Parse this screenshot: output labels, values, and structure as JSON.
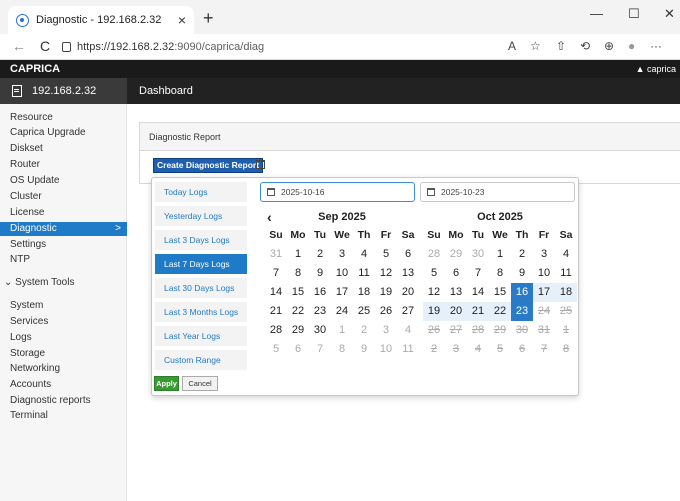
{
  "browser": {
    "tab_title": "Diagnostic - 192.168.2.32",
    "tab_close": "×",
    "new_tab": "+",
    "url_host": "https://192.168.2.32",
    "url_path": ":9090/caprica/diag",
    "window_min": "—",
    "window_max": "☐",
    "window_close": "✕",
    "back": "←",
    "refresh": "C",
    "tools": [
      "A",
      "☆",
      "⇧",
      "⟲",
      "⊕",
      "●",
      "···"
    ]
  },
  "app": {
    "name": "CAPRICA",
    "user": "caprica",
    "device": "192.168.2.32",
    "page_title": "Dashboard"
  },
  "sidebar": {
    "items": [
      {
        "label": "Resource"
      },
      {
        "label": "Caprica Upgrade"
      },
      {
        "label": "Diskset"
      },
      {
        "label": "Router"
      },
      {
        "label": "OS Update"
      },
      {
        "label": "Cluster"
      },
      {
        "label": "License"
      },
      {
        "label": "Diagnostic",
        "active": true,
        "chevron": ">"
      },
      {
        "label": "Settings"
      },
      {
        "label": "NTP"
      }
    ],
    "section": {
      "label": "System Tools",
      "chevron": "⌄"
    },
    "tools": [
      {
        "label": "System"
      },
      {
        "label": "Services"
      },
      {
        "label": "Logs"
      },
      {
        "label": "Storage"
      },
      {
        "label": "Networking"
      },
      {
        "label": "Accounts"
      },
      {
        "label": "Diagnostic reports"
      },
      {
        "label": "Terminal"
      }
    ]
  },
  "main": {
    "panel_title": "Diagnostic Report",
    "create_button": "Create Diagnostic Report"
  },
  "daterange": {
    "ranges": [
      {
        "label": "Today Logs"
      },
      {
        "label": "Yesterday Logs"
      },
      {
        "label": "Last 3 Days Logs"
      },
      {
        "label": "Last 7 Days Logs",
        "active": true
      },
      {
        "label": "Last 30 Days Logs"
      },
      {
        "label": "Last 3 Months Logs"
      },
      {
        "label": "Last Year Logs"
      },
      {
        "label": "Custom Range"
      }
    ],
    "apply": "Apply",
    "cancel": "Cancel",
    "start_date": "2025-10-16",
    "end_date": "2025-10-23",
    "prev_arrow": "‹",
    "dow": [
      "Su",
      "Mo",
      "Tu",
      "We",
      "Th",
      "Fr",
      "Sa"
    ],
    "left": {
      "title": "Sep 2025",
      "days": [
        [
          "31",
          "off"
        ],
        [
          "1",
          ""
        ],
        [
          "2",
          ""
        ],
        [
          "3",
          ""
        ],
        [
          "4",
          ""
        ],
        [
          "5",
          ""
        ],
        [
          "6",
          ""
        ],
        [
          "7",
          ""
        ],
        [
          "8",
          ""
        ],
        [
          "9",
          ""
        ],
        [
          "10",
          ""
        ],
        [
          "11",
          ""
        ],
        [
          "12",
          ""
        ],
        [
          "13",
          ""
        ],
        [
          "14",
          ""
        ],
        [
          "15",
          ""
        ],
        [
          "16",
          ""
        ],
        [
          "17",
          ""
        ],
        [
          "18",
          ""
        ],
        [
          "19",
          ""
        ],
        [
          "20",
          ""
        ],
        [
          "21",
          ""
        ],
        [
          "22",
          ""
        ],
        [
          "23",
          ""
        ],
        [
          "24",
          ""
        ],
        [
          "25",
          ""
        ],
        [
          "26",
          ""
        ],
        [
          "27",
          ""
        ],
        [
          "28",
          ""
        ],
        [
          "29",
          ""
        ],
        [
          "30",
          ""
        ],
        [
          "1",
          "off"
        ],
        [
          "2",
          "off"
        ],
        [
          "3",
          "off"
        ],
        [
          "4",
          "off"
        ],
        [
          "5",
          "off"
        ],
        [
          "6",
          "off"
        ],
        [
          "7",
          "off"
        ],
        [
          "8",
          "off"
        ],
        [
          "9",
          "off"
        ],
        [
          "10",
          "off"
        ],
        [
          "11",
          "off"
        ]
      ]
    },
    "right": {
      "title": "Oct 2025",
      "days": [
        [
          "28",
          "off"
        ],
        [
          "29",
          "off"
        ],
        [
          "30",
          "off"
        ],
        [
          "1",
          ""
        ],
        [
          "2",
          ""
        ],
        [
          "3",
          ""
        ],
        [
          "4",
          ""
        ],
        [
          "5",
          ""
        ],
        [
          "6",
          ""
        ],
        [
          "7",
          ""
        ],
        [
          "8",
          ""
        ],
        [
          "9",
          ""
        ],
        [
          "10",
          ""
        ],
        [
          "11",
          ""
        ],
        [
          "12",
          ""
        ],
        [
          "13",
          ""
        ],
        [
          "14",
          ""
        ],
        [
          "15",
          ""
        ],
        [
          "16",
          "sel"
        ],
        [
          "17",
          "inr"
        ],
        [
          "18",
          "inr"
        ],
        [
          "19",
          "inr"
        ],
        [
          "20",
          "inr"
        ],
        [
          "21",
          "inr"
        ],
        [
          "22",
          "inr"
        ],
        [
          "23",
          "sel"
        ],
        [
          "24",
          "off strike"
        ],
        [
          "25",
          "off strike"
        ],
        [
          "26",
          "off strike"
        ],
        [
          "27",
          "off strike"
        ],
        [
          "28",
          "off strike"
        ],
        [
          "29",
          "off strike"
        ],
        [
          "30",
          "off strike"
        ],
        [
          "31",
          "off strike"
        ],
        [
          "1",
          "off strike"
        ],
        [
          "2",
          "off strike"
        ],
        [
          "3",
          "off strike"
        ],
        [
          "4",
          "off strike"
        ],
        [
          "5",
          "off strike"
        ],
        [
          "6",
          "off strike"
        ],
        [
          "7",
          "off strike"
        ],
        [
          "8",
          "off strike"
        ]
      ]
    }
  }
}
